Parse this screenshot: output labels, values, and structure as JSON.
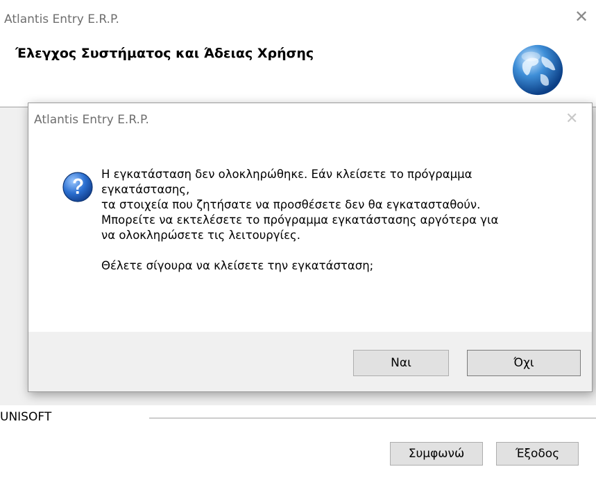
{
  "window": {
    "title": "Atlantis Entry E.R.P.",
    "close_glyph": "✕",
    "heading": "Έλεγχος Συστήματος και Άδειας Χρήσης",
    "brand": "UNISOFT",
    "agree_label": "Συμφωνώ",
    "exit_label": "Έξοδος"
  },
  "dialog": {
    "title": "Atlantis Entry E.R.P.",
    "close_glyph": "✕",
    "lines": [
      "Η εγκατάσταση δεν ολοκληρώθηκε. Εάν κλείσετε το πρόγραμμα",
      "εγκατάστασης,",
      "τα στοιχεία που ζητήσατε να προσθέσετε δεν θα εγκατασταθούν.",
      "Μπορείτε να εκτελέσετε το πρόγραμμα εγκατάστασης αργότερα για",
      "να ολοκληρώσετε τις λειτουργίες."
    ],
    "question": "Θέλετε σίγουρα να κλείσετε την εγκατάσταση;",
    "yes_label": "Ναι",
    "no_label": "Όχι"
  },
  "icons": {
    "globe": "globe-icon",
    "question": "question-icon",
    "close": "close-icon"
  },
  "colors": {
    "question_icon": "#1f5fbf",
    "footer_bg": "#f0f0f0",
    "button_bg": "#e1e1e1"
  }
}
